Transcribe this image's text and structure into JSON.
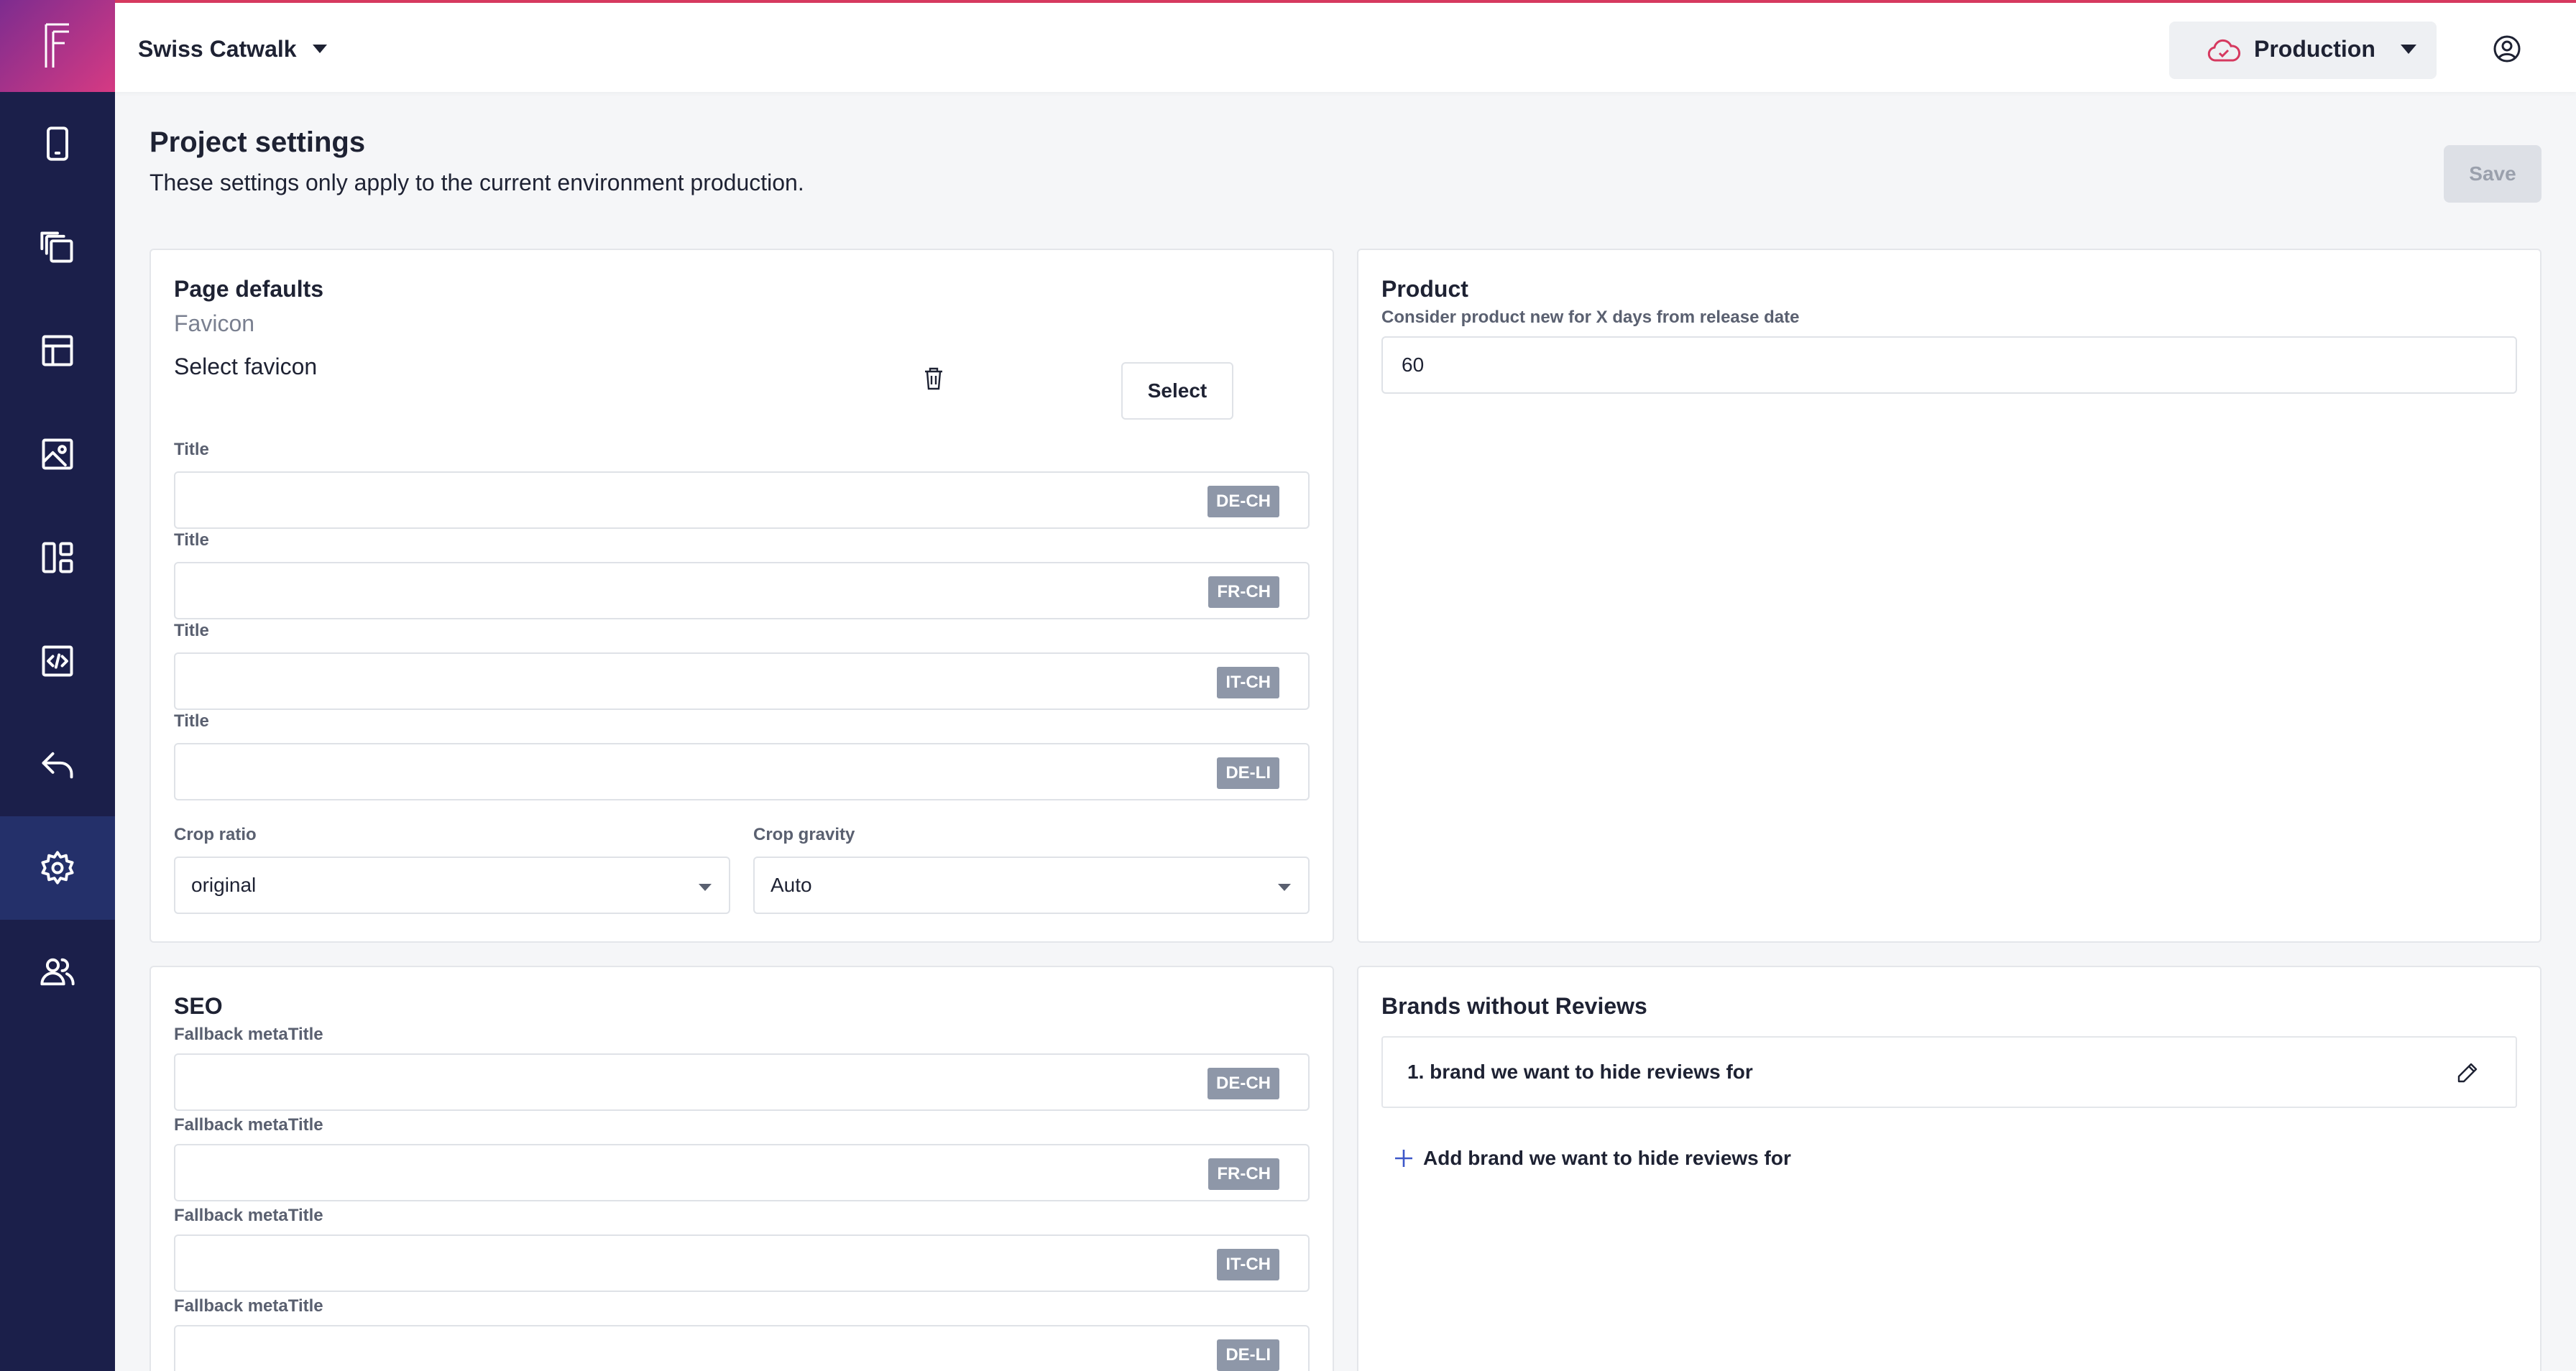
{
  "app": {
    "project_name": "Swiss Catwalk",
    "environment": "Production",
    "brand_color": "#d6395f",
    "sidebar_color": "#1b1f4a"
  },
  "sidebar": {
    "items": [
      {
        "icon": "mobile-icon"
      },
      {
        "icon": "pages-icon"
      },
      {
        "icon": "layout-icon"
      },
      {
        "icon": "media-icon"
      },
      {
        "icon": "dashboard-icon"
      },
      {
        "icon": "code-icon"
      },
      {
        "icon": "undo-icon"
      },
      {
        "icon": "settings-icon",
        "active": true
      },
      {
        "icon": "users-icon"
      }
    ]
  },
  "header": {
    "title": "Project settings",
    "subtitle": "These settings only apply to the current environment production.",
    "save_label": "Save"
  },
  "page_defaults": {
    "title": "Page defaults",
    "favicon_label": "Favicon",
    "favicon_text": "Select favicon",
    "select_button": "Select",
    "title_fields": [
      {
        "label": "Title",
        "locale": "DE-CH",
        "value": ""
      },
      {
        "label": "Title",
        "locale": "FR-CH",
        "value": ""
      },
      {
        "label": "Title",
        "locale": "IT-CH",
        "value": ""
      },
      {
        "label": "Title",
        "locale": "DE-LI",
        "value": ""
      }
    ],
    "crop_ratio_label": "Crop ratio",
    "crop_ratio_value": "original",
    "crop_gravity_label": "Crop gravity",
    "crop_gravity_value": "Auto"
  },
  "product": {
    "title": "Product",
    "new_days_label": "Consider product new for X days from release date",
    "new_days_value": "60"
  },
  "seo": {
    "title": "SEO",
    "fields": [
      {
        "label": "Fallback metaTitle",
        "locale": "DE-CH",
        "value": ""
      },
      {
        "label": "Fallback metaTitle",
        "locale": "FR-CH",
        "value": ""
      },
      {
        "label": "Fallback metaTitle",
        "locale": "IT-CH",
        "value": ""
      },
      {
        "label": "Fallback metaTitle",
        "locale": "DE-LI",
        "value": ""
      }
    ]
  },
  "brands": {
    "title": "Brands without Reviews",
    "items": [
      "1. brand we want to hide reviews for"
    ],
    "add_label": "Add brand we want to hide reviews for"
  }
}
